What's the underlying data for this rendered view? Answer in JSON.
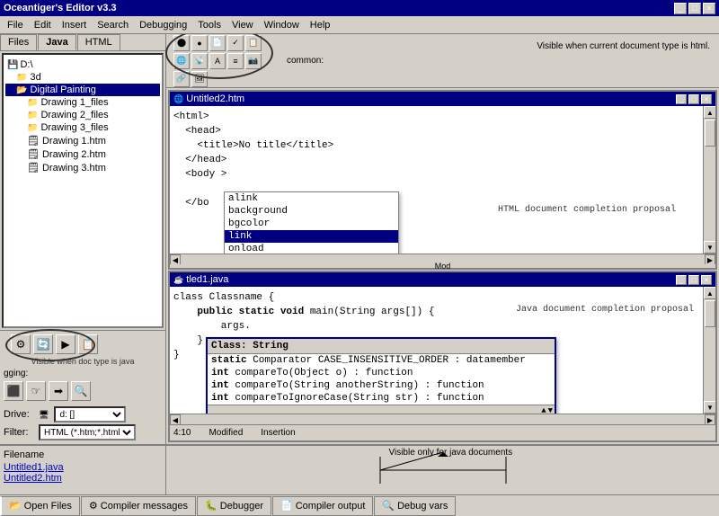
{
  "app": {
    "title": "Oceantiger's Editor v3.3",
    "title_controls": [
      "_",
      "□",
      "×"
    ]
  },
  "menu": {
    "items": [
      "File",
      "Edit",
      "Insert",
      "Search",
      "Debugging",
      "Tools",
      "View",
      "Window",
      "Help"
    ]
  },
  "tabs": {
    "left": [
      "Files",
      "Java",
      "HTML"
    ]
  },
  "file_tree": {
    "items": [
      {
        "label": "D:\\",
        "type": "drive",
        "indent": 0
      },
      {
        "label": "3d",
        "type": "folder",
        "indent": 1
      },
      {
        "label": "Digital Painting",
        "type": "folder",
        "indent": 1,
        "selected": true
      },
      {
        "label": "Drawing 1_files",
        "type": "folder",
        "indent": 2
      },
      {
        "label": "Drawing 2_files",
        "type": "folder",
        "indent": 2
      },
      {
        "label": "Drawing 3_files",
        "type": "folder",
        "indent": 2
      },
      {
        "label": "Drawing 1.htm",
        "type": "file",
        "indent": 2
      },
      {
        "label": "Drawing 2.htm",
        "type": "file",
        "indent": 2
      },
      {
        "label": "Drawing 3.htm",
        "type": "file",
        "indent": 2
      }
    ]
  },
  "drive_row": {
    "label": "Drive:",
    "value": "d: []",
    "filter_label": "Filter:",
    "filter_value": "HTML (*.htm;*.html"
  },
  "editor_top": {
    "title": "Untitled2.htm",
    "content_lines": [
      "<html>",
      "  <head>",
      "    <title>No title</title>",
      "  </head>",
      "  <body >",
      "",
      "  </bo"
    ]
  },
  "html_completion": {
    "items": [
      "alink",
      "background",
      "bgcolor",
      "link",
      "onload"
    ],
    "selected": "link"
  },
  "editor_bottom": {
    "title": "tled1.java",
    "content_lines": [
      "class Classname {",
      "    public static void main(String args[]) {",
      "        args.",
      "    }",
      "}"
    ],
    "status": {
      "position": "4:10",
      "modified": "Modified",
      "insertion": "Insertion"
    }
  },
  "java_completion": {
    "header": "Class: String",
    "items": [
      "static Comparator CASE_INSENSITIVE_ORDER : datamember",
      "int compareTo(Object o) : function",
      "int compareTo(String anotherString) : function",
      "int compareToIgnoreCase(String str) : function"
    ]
  },
  "annotations": {
    "html_visible": "Visible when current document type is html.",
    "html_completion_label": "HTML document completion proposal",
    "java_visible_doc": "Visible when doc type is java",
    "java_visible_label": "Visible only for java documents",
    "java_completion_label": "Java document completion proposal"
  },
  "bottom_panel": {
    "filename_header": "Filename",
    "files": [
      "Untitled1.java",
      "Untitled2.htm"
    ],
    "annotation": "Visible only for java documents"
  },
  "bottom_tabs": [
    {
      "label": "Open Files",
      "icon": "folder"
    },
    {
      "label": "Compiler messages",
      "icon": "gear"
    },
    {
      "label": "Debugger",
      "icon": "bug"
    },
    {
      "label": "Compiler output",
      "icon": "page"
    },
    {
      "label": "Debug vars",
      "icon": "search"
    }
  ],
  "toolbar_icons": {
    "common_label": "common:",
    "visible_html": "Visible when current document type is html.",
    "debugging_label": "gging:"
  }
}
